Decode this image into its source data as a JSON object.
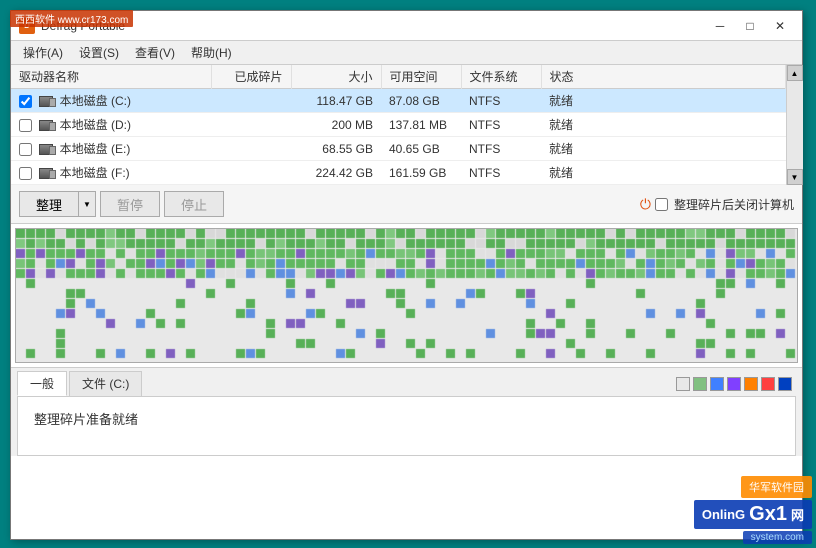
{
  "window": {
    "title": "Defrag Portable",
    "site_badge": "西西软件 www.cr173.com"
  },
  "menu": {
    "items": [
      "操作(A)",
      "设置(S)",
      "查看(V)",
      "帮助(H)"
    ]
  },
  "drive_table": {
    "headers": [
      "驱动器名称",
      "已成碎片",
      "大小",
      "可用空间",
      "文件系统",
      "状态"
    ],
    "rows": [
      {
        "checked": true,
        "label": "本地磁盘 (C:)",
        "fragmented": "",
        "size": "118.47 GB",
        "free": "87.08 GB",
        "fs": "NTFS",
        "status": "就绪"
      },
      {
        "checked": false,
        "label": "本地磁盘 (D:)",
        "fragmented": "",
        "size": "200 MB",
        "free": "137.81 MB",
        "fs": "NTFS",
        "status": "就绪"
      },
      {
        "checked": false,
        "label": "本地磁盘 (E:)",
        "fragmented": "",
        "size": "68.55 GB",
        "free": "40.65 GB",
        "fs": "NTFS",
        "status": "就绪"
      },
      {
        "checked": false,
        "label": "本地磁盘 (F:)",
        "fragmented": "",
        "size": "224.42 GB",
        "free": "161.59 GB",
        "fs": "NTFS",
        "status": "就绪"
      }
    ]
  },
  "toolbar": {
    "defrag_label": "整理",
    "pause_label": "暂停",
    "stop_label": "停止",
    "shutdown_label": "整理碎片后关闭计算机"
  },
  "tabs": {
    "items": [
      "一般",
      "文件 (C:)"
    ],
    "active": 0
  },
  "legend": {
    "colors": [
      "#e8e8e8",
      "#80c080",
      "#4080ff",
      "#8040ff",
      "#ff8000",
      "#ff4040",
      "#0040c0"
    ]
  },
  "status": {
    "text": "整理碎片准备就绪"
  },
  "watermark": {
    "line1": "华军软件园",
    "line2": "OnlinG  X1网",
    "line3": "system.com"
  }
}
